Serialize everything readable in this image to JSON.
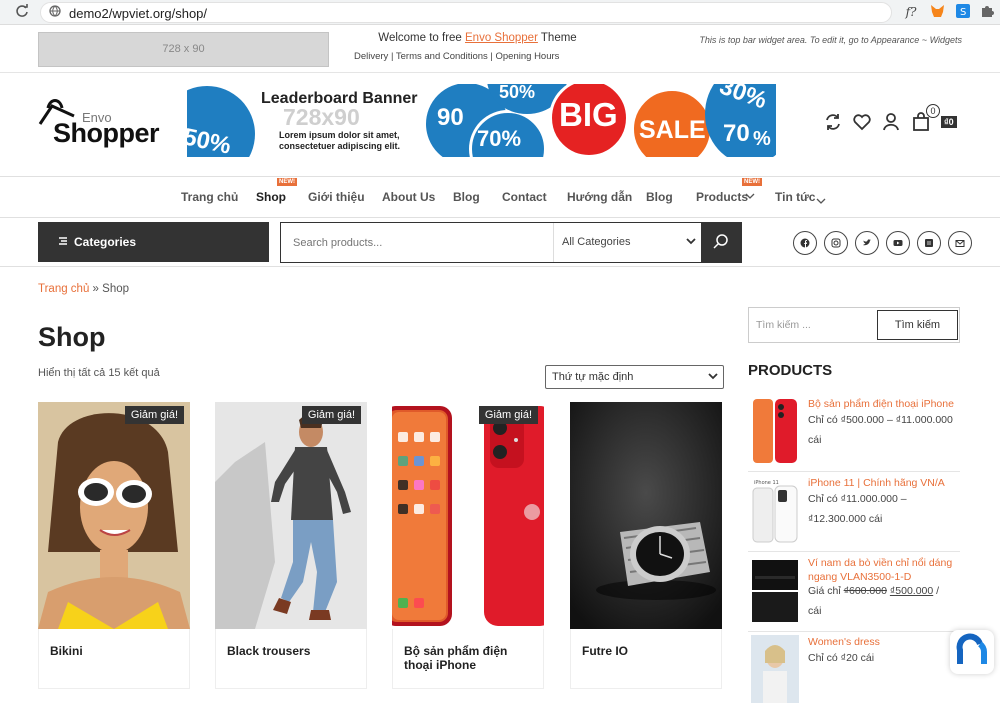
{
  "browser": {
    "url": "demo2/wpviet.org/shop/",
    "ext_font_label": "f?"
  },
  "topbar": {
    "ad_small": "728 x 90",
    "welcome_pre": "Welcome to free ",
    "welcome_link": "Envo Shopper",
    "welcome_post": " Theme",
    "links": "Delivery | Terms and Conditions | Opening Hours",
    "widget_note": "This is top bar widget area. To edit it, go to Appearance ~ Widgets"
  },
  "header": {
    "logo_top": "Envo",
    "logo_main": "Shopper",
    "banner_title": "Leaderboard Banner",
    "banner_size": "728x90",
    "banner_lorem": "Lorem ipsum dolor sit amet, consectetuer adipiscing elit.",
    "banner_big": "BIG",
    "banner_sale": "SALE",
    "banner_pcts": [
      "50%",
      "90",
      "70%",
      "50%",
      "30%",
      "70",
      "%"
    ],
    "cart_count": "0",
    "cart_total": "₫0"
  },
  "nav": {
    "items": [
      "Trang chủ",
      "Shop",
      "Giới thiệu",
      "About Us",
      "Blog",
      "Contact",
      "Hướng dẫn",
      "Blog",
      "Products",
      "Tin tức"
    ],
    "new_badge": "NEW!"
  },
  "searchbar": {
    "categories_label": "Categories",
    "placeholder": "Search products...",
    "category_select": "All Categories"
  },
  "social": [
    "facebook-icon",
    "instagram-icon",
    "twitter-icon",
    "youtube-icon",
    "skype-icon",
    "email-icon"
  ],
  "content": {
    "breadcrumb_home": "Trang chủ",
    "breadcrumb_sep": " » ",
    "breadcrumb_current": "Shop",
    "title": "Shop",
    "result_count": "Hiển thị tất cả 15 kết quả",
    "orderby": "Thứ tự mặc định"
  },
  "products": [
    {
      "name": "Bikini",
      "sale": "Giảm giá!"
    },
    {
      "name": "Black trousers",
      "sale": "Giảm giá!"
    },
    {
      "name": "Bộ sản phẩm điện thoại iPhone",
      "sale": "Giảm giá!"
    },
    {
      "name": "Futre IO",
      "sale": ""
    }
  ],
  "sidebar": {
    "search_placeholder": "Tìm kiếm ...",
    "search_button": "Tìm kiếm",
    "products_heading": "PRODUCTS",
    "items": [
      {
        "title": "Bộ sản phẩm điện thoại iPhone",
        "price_l1": "Chỉ có ₫500.000 – ₫11.000.000",
        "price_l2": "cái"
      },
      {
        "title": "iPhone 11 | Chính hãng VN/A",
        "price_l1": "Chỉ có ₫11.000.000 –",
        "price_l2": "₫12.300.000 cái"
      },
      {
        "title": "Ví nam da bò viền chỉ nổi dáng ngang VLAN3500-1-D",
        "price_pre": "Giá chỉ ",
        "price_old": "₫600.000",
        "price_new": "₫500.000",
        "price_post": " /",
        "price_l2": "cái"
      },
      {
        "title": "Women's dress",
        "price_l1": "Chỉ có ₫20 cái",
        "price_l2": ""
      }
    ]
  },
  "colors": {
    "accent": "#e8703a",
    "dark": "#333333"
  }
}
